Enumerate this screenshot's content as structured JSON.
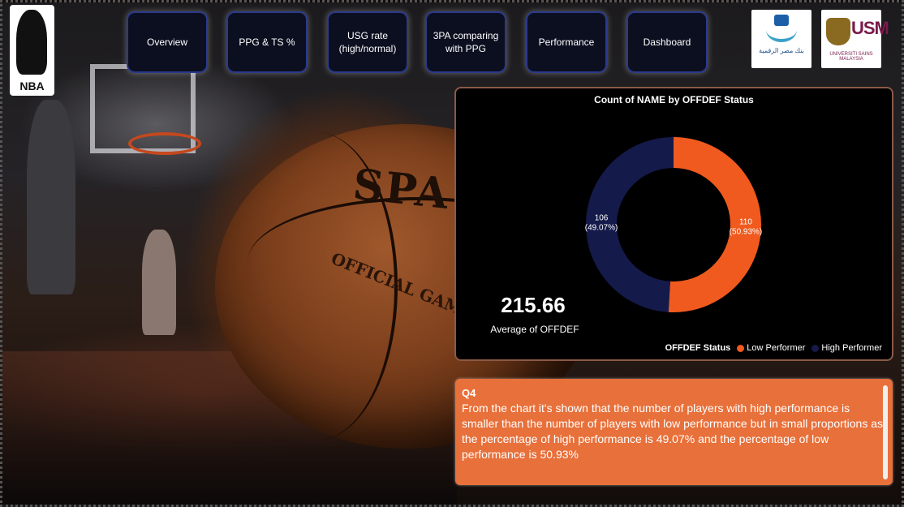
{
  "nav": {
    "buttons": [
      {
        "label": "Overview"
      },
      {
        "label": "PPG & TS %"
      },
      {
        "label": "USG rate (high/normal)"
      },
      {
        "label": "3PA comparing with PPG"
      },
      {
        "label": "Performance"
      },
      {
        "label": "Dashboard"
      }
    ]
  },
  "logos": {
    "nba_text": "NBA",
    "left_logo_caption": "بنك مصر الرقمية",
    "usm_text": "USM",
    "usm_caption": "UNIVERSITI SAINS MALAYSIA"
  },
  "ball": {
    "brand": "SPA",
    "sub": "OFFICIAL GAME BALL"
  },
  "chart_data": {
    "type": "pie",
    "title": "Count of NAME by OFFDEF Status",
    "legend_title": "OFFDEF Status",
    "legend_position": "bottom-right",
    "slices": [
      {
        "name": "Low Performer",
        "value": 110,
        "label": "110",
        "pct_label": "(50.93%)",
        "color": "#f05a1e"
      },
      {
        "name": "High Performer",
        "value": 106,
        "label": "106",
        "pct_label": "(49.07%)",
        "color": "#141a4a"
      }
    ]
  },
  "kpi": {
    "value": "215.66",
    "label": "Average of OFFDEF"
  },
  "insight": {
    "heading": "Q4",
    "text": "From the chart it's shown that the number of players with high performance is smaller than the number of players with low performance but in small proportions as the percentage of high performance is 49.07% and the percentage of low performance is 50.93%"
  }
}
